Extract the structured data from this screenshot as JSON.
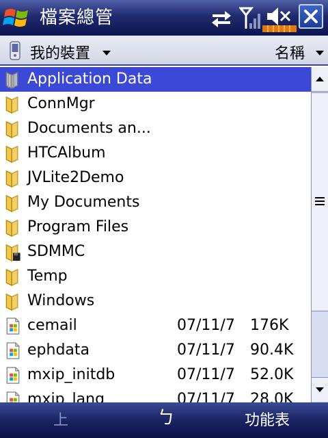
{
  "titlebar": {
    "app_title": "檔案總管",
    "icons": [
      "windows-start-icon",
      "connectivity-icon",
      "signal-icon",
      "speaker-muted-icon",
      "battery-icon"
    ],
    "close_label": "X"
  },
  "header": {
    "location": "我的裝置",
    "sort_by": "名稱"
  },
  "files": [
    {
      "name": "Application Data",
      "type": "folder-hidden",
      "date": "",
      "size": "",
      "selected": true
    },
    {
      "name": "ConnMgr",
      "type": "folder",
      "date": "",
      "size": ""
    },
    {
      "name": "Documents an...",
      "type": "folder",
      "date": "",
      "size": ""
    },
    {
      "name": "HTCAlbum",
      "type": "folder",
      "date": "",
      "size": ""
    },
    {
      "name": "JVLite2Demo",
      "type": "folder",
      "date": "",
      "size": ""
    },
    {
      "name": "My Documents",
      "type": "folder",
      "date": "",
      "size": ""
    },
    {
      "name": "Program Files",
      "type": "folder",
      "date": "",
      "size": ""
    },
    {
      "name": "SDMMC",
      "type": "folder-storage-card",
      "date": "",
      "size": ""
    },
    {
      "name": "Temp",
      "type": "folder",
      "date": "",
      "size": ""
    },
    {
      "name": "Windows",
      "type": "folder",
      "date": "",
      "size": ""
    },
    {
      "name": "cemail",
      "type": "file",
      "date": "07/11/7",
      "size": "176K"
    },
    {
      "name": "ephdata",
      "type": "file",
      "date": "07/11/7",
      "size": "90.4K"
    },
    {
      "name": "mxip_initdb",
      "type": "file",
      "date": "07/11/7",
      "size": "52.0K"
    },
    {
      "name": "mxip_lang",
      "type": "file",
      "date": "07/11/7",
      "size": "28.0K"
    }
  ],
  "softkeys": {
    "left": "上",
    "center_icon": "input-method-icon",
    "center_label": "ㄅ",
    "right": "功能表"
  },
  "colors": {
    "selection": "#3b49d6",
    "titlebar": "#1f2a6e",
    "softkey_disabled": "#8a93c4"
  }
}
